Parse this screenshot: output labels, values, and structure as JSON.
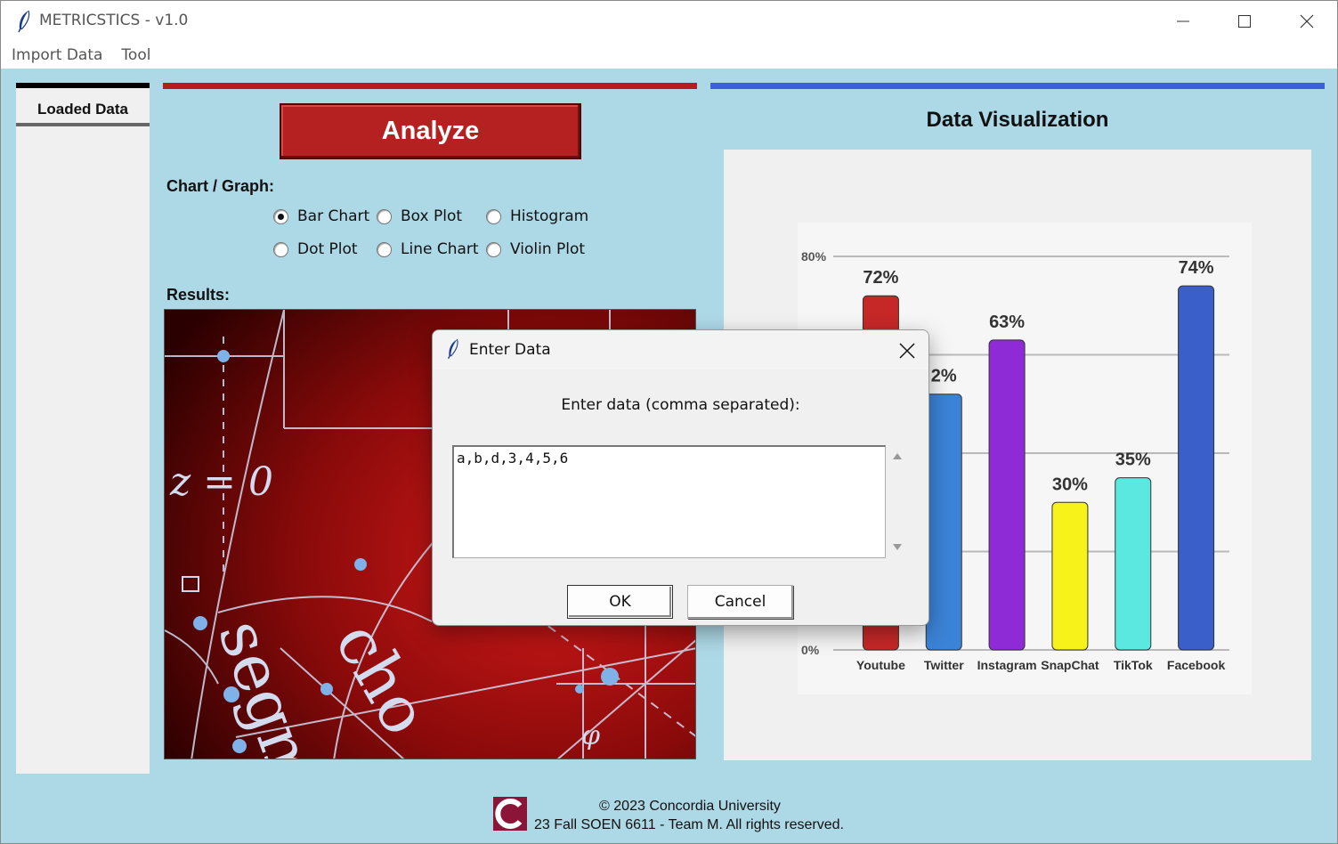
{
  "window": {
    "title": "METRICSTICS - v1.0"
  },
  "menu": {
    "items": [
      "Import Data",
      "Tool"
    ]
  },
  "left_panel": {
    "tab_label": "Loaded Data"
  },
  "main": {
    "analyze_label": "Analyze",
    "chart_graph_label": "Chart / Graph:",
    "results_label": "Results:",
    "radio_options": [
      {
        "label": "Bar Chart",
        "selected": true
      },
      {
        "label": "Box Plot",
        "selected": false
      },
      {
        "label": "Histogram",
        "selected": false
      },
      {
        "label": "Dot Plot",
        "selected": false
      },
      {
        "label": "Line Chart",
        "selected": false
      },
      {
        "label": "Violin Plot",
        "selected": false
      }
    ],
    "results_image_text": [
      "z = 0",
      "segm",
      "cho",
      "φ"
    ]
  },
  "visualization": {
    "title": "Data Visualization"
  },
  "chart_data": {
    "type": "bar",
    "categories": [
      "Youtube",
      "Twitter",
      "Instagram",
      "SnapChat",
      "TikTok",
      "Facebook"
    ],
    "values": [
      72,
      52,
      63,
      30,
      35,
      74
    ],
    "labels": [
      "72%",
      "2%",
      "63%",
      "30%",
      "35%",
      "74%"
    ],
    "ytick_labels": [
      "80%",
      "0%"
    ],
    "ylim": [
      0,
      80
    ],
    "grid": true,
    "colors": [
      "#c62828",
      "#3b83d6",
      "#8e2bd6",
      "#f7f21a",
      "#5ae8e0",
      "#3b5fc9"
    ]
  },
  "footer": {
    "line1": "© 2023 Concordia University",
    "line2": "23 Fall SOEN 6611 - Team M. All rights reserved.",
    "logo_letter": "C"
  },
  "dialog": {
    "title": "Enter Data",
    "prompt": "Enter data (comma separated):",
    "input_value": "a,b,d,3,4,5,6",
    "ok_label": "OK",
    "cancel_label": "Cancel"
  },
  "icons": {
    "app": "feather-icon",
    "minimize": "minimize-icon",
    "maximize": "maximize-icon",
    "close": "close-icon"
  }
}
